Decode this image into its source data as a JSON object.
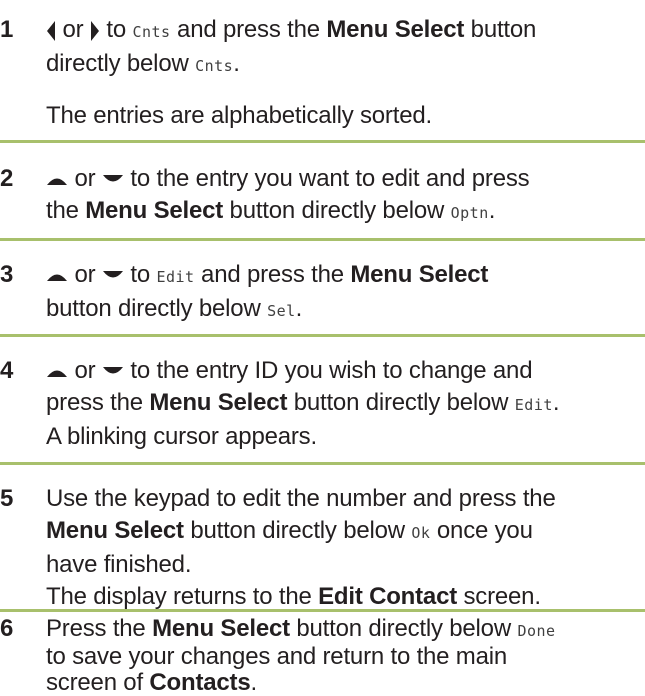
{
  "steps": [
    {
      "number": "1",
      "lines": [
        {
          "connector": "or",
          "to": "to",
          "lcd": "Cnts",
          "and_press": "and press the",
          "menu_select": "Menu Select",
          "button": "button"
        },
        {
          "directly_below": "directly below",
          "lcd": "Cnts",
          "period": "."
        }
      ],
      "note": "The entries are alphabetically sorted."
    },
    {
      "number": "2",
      "line1": {
        "connector": "or",
        "rest": "to the entry you want to edit and press"
      },
      "line2": {
        "the": "the",
        "menu_select": "Menu Select",
        "rest": "button directly below",
        "lcd": "Optn",
        "period": "."
      }
    },
    {
      "number": "3",
      "line1": {
        "connector": "or",
        "to": "to",
        "lcd": "Edit",
        "and_press": "and press the",
        "menu_select": "Menu Select"
      },
      "line2": {
        "rest": "button directly below",
        "lcd": "Sel",
        "period": "."
      }
    },
    {
      "number": "4",
      "line1": {
        "connector": "or",
        "rest": "to the entry ID you wish to change and"
      },
      "line2": {
        "press": "press the",
        "menu_select": "Menu Select",
        "rest": "button directly below",
        "lcd": "Edit",
        "period": "."
      },
      "line3": "A blinking cursor appears."
    },
    {
      "number": "5",
      "line1": "Use the keypad to edit the number and press the",
      "line2": {
        "menu_select": "Menu Select",
        "rest": "button directly below",
        "lcd": "Ok",
        "after": "once you"
      },
      "line3": "have finished.",
      "line4": {
        "text": "The display returns to the",
        "bold": "Edit Contact",
        "after": "screen."
      }
    },
    {
      "number": "6",
      "line1": {
        "press": "Press the",
        "menu_select": "Menu Select",
        "rest": "button directly below",
        "lcd": "Done"
      },
      "line2": "to save your changes and return to the main",
      "line3": {
        "text": "screen of",
        "bold": "Contacts",
        "period": "."
      }
    }
  ],
  "icons": {
    "left": "left-arrow-icon",
    "right": "right-arrow-icon",
    "up": "up-arrow-icon",
    "down": "down-arrow-icon"
  },
  "colors": {
    "separator": "#a8c06c",
    "text": "#231f20"
  }
}
